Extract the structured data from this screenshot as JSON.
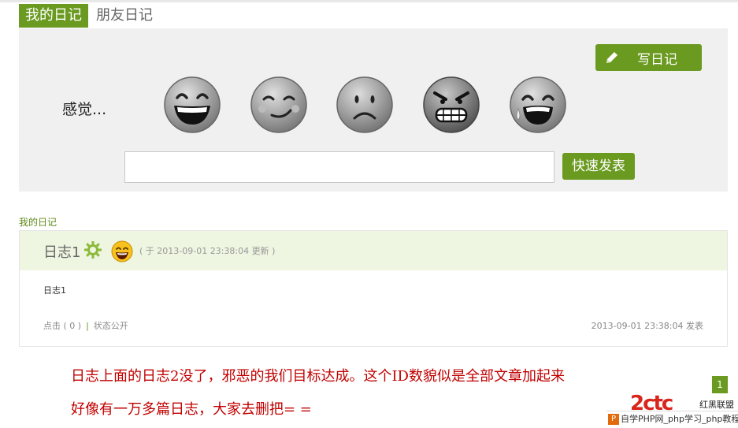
{
  "tabs": [
    {
      "label": "我的日记",
      "active": true
    },
    {
      "label": "朋友日记",
      "active": false
    }
  ],
  "mood_panel": {
    "write_button": "写日记",
    "feel_label": "感觉...",
    "faces": [
      "laughing-face-icon",
      "winking-face-icon",
      "sad-face-icon",
      "angry-face-icon",
      "crying-face-icon"
    ],
    "quick_post_placeholder": "",
    "quick_post_button": "快速发表"
  },
  "diary_list": {
    "section_title": "我的日记",
    "entries": [
      {
        "title": "日志1",
        "updated": "( 于 2013-09-01 23:38:04 更新 )",
        "body": "日志1",
        "clicks": "点击 ( 0 )",
        "status": "状态公开",
        "posted": "2013-09-01 23:38:04 发表"
      }
    ]
  },
  "comment": {
    "line1": "日志上面的日志2没了，邪恶的我们目标达成。这个ID数貌似是全部文章加起来",
    "line2": "好像有一万多篇日志，大家去删把= ="
  },
  "pager": {
    "current": "1"
  },
  "watermark": {
    "logo": "2ctc",
    "brand": "红黑联盟",
    "bar_text": "自学PHP网_php学习_php教程"
  },
  "colors": {
    "accent": "#6a9a1f",
    "comment": "#c00000",
    "panel_bg": "#f0f0f0",
    "entry_head_bg": "#eef5e0"
  }
}
